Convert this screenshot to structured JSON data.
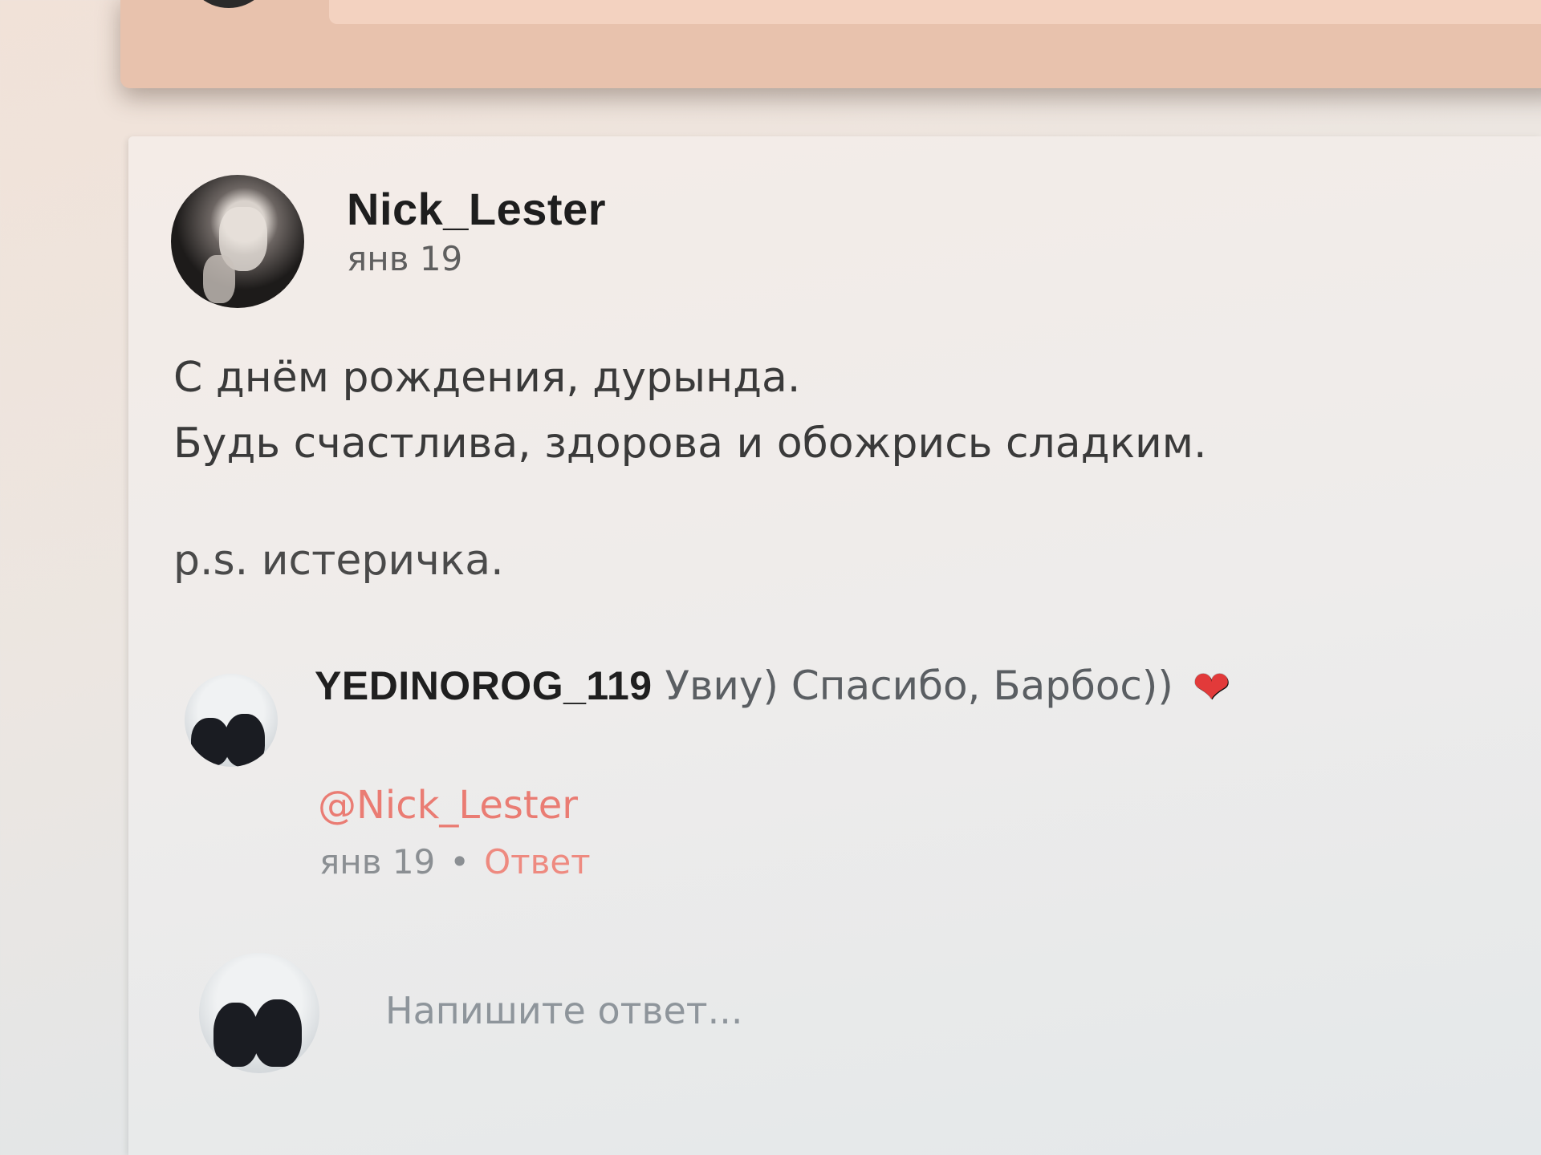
{
  "post": {
    "author": "Nick_Lester",
    "date": "янв 19",
    "lines": [
      "С днём рождения, дурында.",
      "Будь счастлива, здорова и обожрись сладким."
    ],
    "ps": "p.s. истеричка."
  },
  "reply": {
    "user": "YEDINOROG_119",
    "text": "Увиу) Спасибо, Барбос))",
    "emoji": "❤",
    "mention": "@Nick_Lester",
    "date": "янв 19",
    "separator": "•",
    "reply_label": "Ответ"
  },
  "compose": {
    "placeholder": "Напишите ответ..."
  },
  "colors": {
    "accent": "#ea7c73",
    "heart": "#e23a3a"
  }
}
